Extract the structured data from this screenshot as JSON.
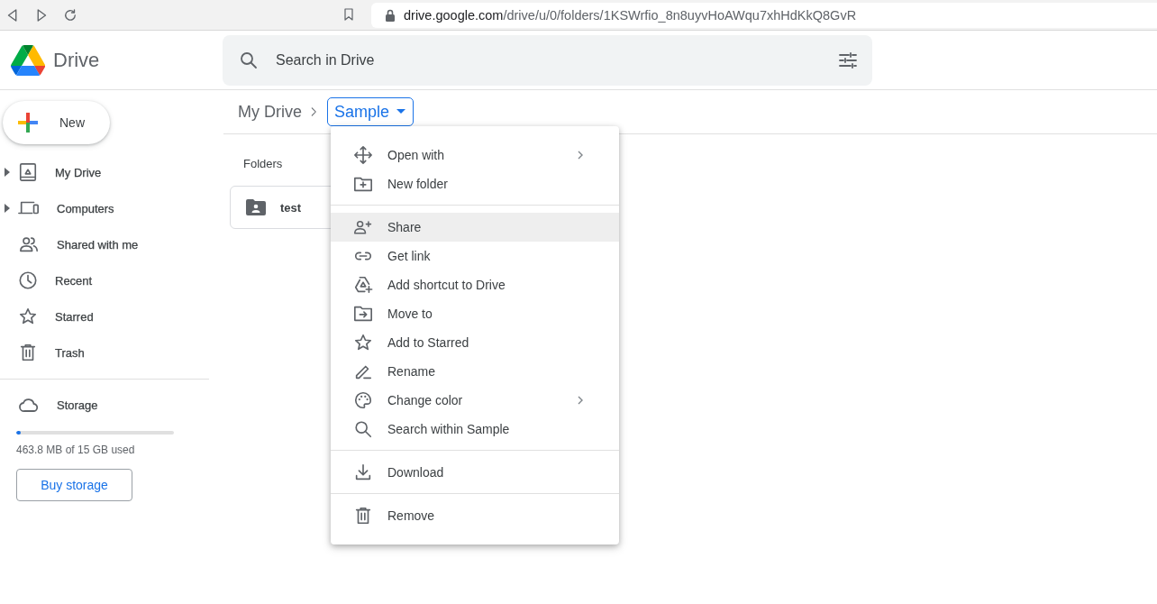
{
  "browser": {
    "url_host": "drive.google.com",
    "url_path": "/drive/u/0/folders/1KSWrfio_8n8uyvHoAWqu7xhHdKkQ8GvR"
  },
  "header": {
    "app_name": "Drive",
    "search": {
      "placeholder": "Search in Drive"
    }
  },
  "new_button": {
    "label": "New"
  },
  "sidebar": {
    "items": [
      {
        "label": "My Drive",
        "expandable": true,
        "selected": false
      },
      {
        "label": "Computers",
        "expandable": true,
        "selected": false
      },
      {
        "label": "Shared with me",
        "expandable": false,
        "selected": false
      },
      {
        "label": "Recent",
        "expandable": false,
        "selected": false
      },
      {
        "label": "Starred",
        "expandable": false,
        "selected": false
      },
      {
        "label": "Trash",
        "expandable": false,
        "selected": false
      }
    ]
  },
  "storage": {
    "label": "Storage",
    "level": 0.03,
    "usage": "463.8 MB of 15 GB used",
    "button": "Buy storage"
  },
  "breadcrumb": {
    "parent": "My Drive",
    "current": "Sample"
  },
  "folders": {
    "heading": "Folders",
    "items": [
      {
        "name": "test"
      }
    ]
  },
  "context_menu": {
    "groups": [
      [
        {
          "label": "Open with",
          "submenu": true,
          "selected": false
        },
        {
          "label": "New folder",
          "submenu": false,
          "selected": false
        }
      ],
      [
        {
          "label": "Share",
          "submenu": false,
          "selected": true
        },
        {
          "label": "Get link",
          "submenu": false,
          "selected": false
        },
        {
          "label": "Add shortcut to Drive",
          "submenu": false,
          "selected": false
        },
        {
          "label": "Move to",
          "submenu": false,
          "selected": false
        },
        {
          "label": "Add to Starred",
          "submenu": false,
          "selected": false
        },
        {
          "label": "Rename",
          "submenu": false,
          "selected": false
        },
        {
          "label": "Change color",
          "submenu": true,
          "selected": false
        },
        {
          "label": "Search within Sample",
          "submenu": false,
          "selected": false
        }
      ],
      [
        {
          "label": "Download",
          "submenu": false,
          "selected": false
        }
      ],
      [
        {
          "label": "Remove",
          "submenu": false,
          "selected": false
        }
      ]
    ]
  }
}
